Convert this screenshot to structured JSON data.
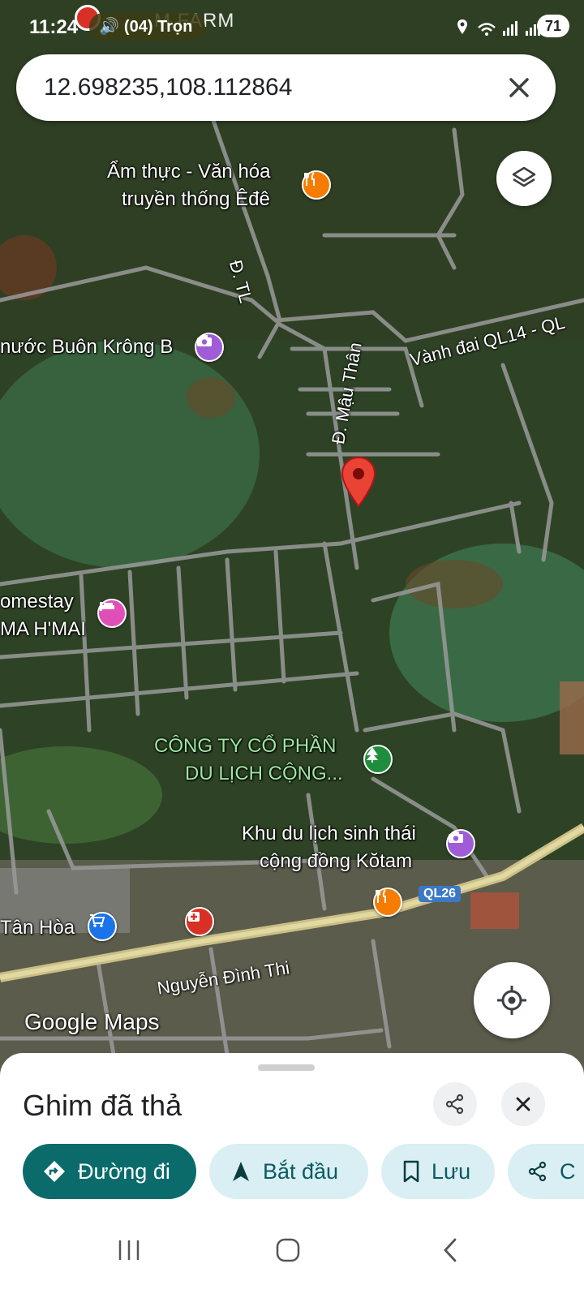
{
  "status_bar": {
    "time": "11:24",
    "media_pill": "(04) Trọn",
    "farm_text": "M FARM",
    "battery": "71"
  },
  "search": {
    "value": "12.698235,108.112864"
  },
  "map": {
    "labels": {
      "restaurant_line1": "Ẩm thực - Văn hóa",
      "restaurant_line2": "truyền thống Êđê",
      "buon_krong": "nước Buôn Krông B",
      "homestay_line1": "omestay",
      "homestay_line2": "MA H'MAI",
      "company_line1": "CÔNG TY CỔ PHẦN",
      "company_line2": "DU LỊCH CỘNG...",
      "eco_line1": "Khu du lịch sinh thái",
      "eco_line2": "cộng đồng Kŏtam",
      "tan_hoa": "Tân Hòa",
      "road_tl": "Đ. TL",
      "road_mau_than": "Đ. Mậu Thân",
      "road_vanh_dai": "Vành đai QL14 - QL",
      "road_nguyen_dinh_thi": "Nguyễn Đình Thi",
      "shield_ql26": "QL26",
      "attribution": "Google Maps"
    },
    "icons": {
      "restaurant": "fork-knife-icon",
      "attraction": "camera-icon",
      "hotel": "bed-icon",
      "park": "tree-icon",
      "shop": "cart-icon",
      "pharmacy": "pharmacy-icon"
    },
    "colors": {
      "restaurant": "#f57c00",
      "attraction": "#a05cd6",
      "hotel": "#e04fb8",
      "park": "#1e8e3e",
      "shop": "#1a73e8",
      "pharmacy": "#d93025",
      "pin": "#ea4335"
    }
  },
  "sheet": {
    "title": "Ghim đã thả",
    "actions": {
      "directions": "Đường đi",
      "start": "Bắt đầu",
      "save": "Lưu",
      "share_partial": "C"
    }
  }
}
